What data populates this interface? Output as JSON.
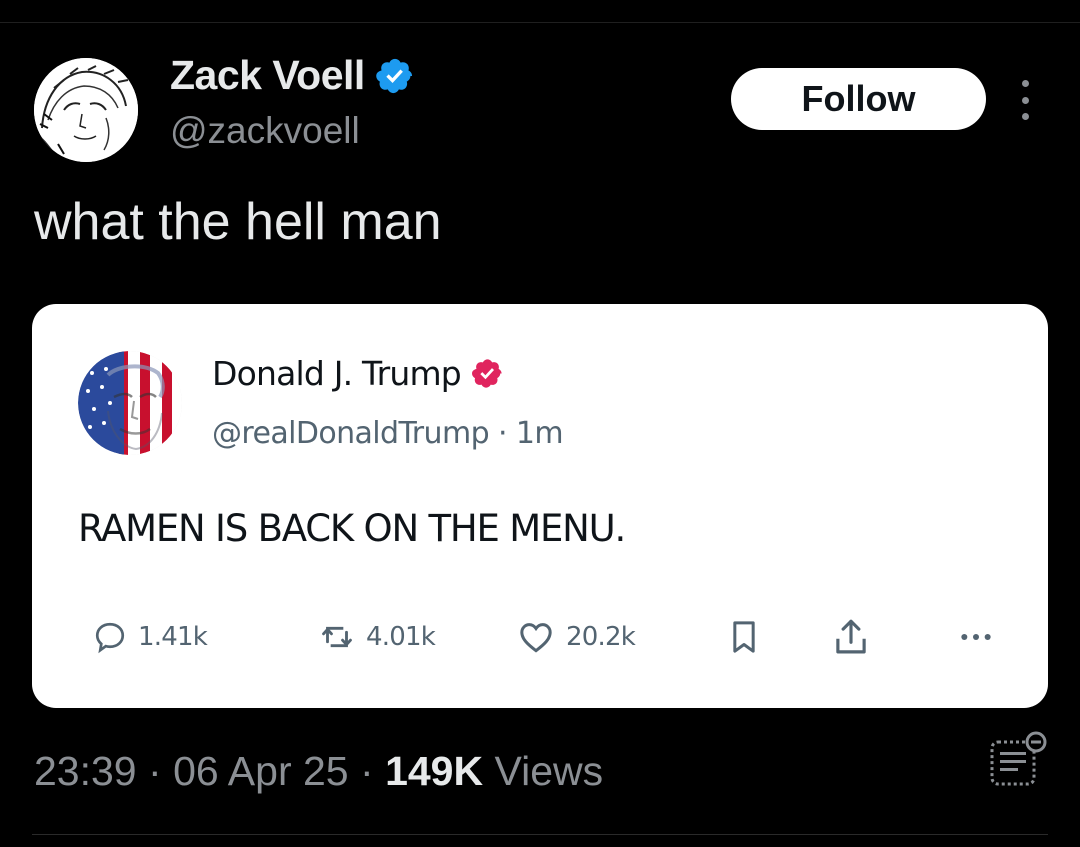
{
  "author": {
    "name": "Zack Voell",
    "handle": "@zackvoell",
    "verified": true
  },
  "follow_label": "Follow",
  "tweet_text": "what the hell man",
  "quoted": {
    "name": "Donald J. Trump",
    "handle": "@realDonaldTrump",
    "separator": "·",
    "time": "1m",
    "text": "RAMEN IS BACK ON THE MENU.",
    "stats": {
      "replies": "1.41k",
      "reposts": "4.01k",
      "likes": "20.2k"
    }
  },
  "meta": {
    "time": "23:39",
    "date": "06 Apr 25",
    "views_count": "149K",
    "views_label": "Views",
    "dot": "·"
  },
  "colors": {
    "background": "#000000",
    "verified_blue": "#1d9bf0",
    "verified_red": "#e0245e",
    "muted": "#8b8f94"
  }
}
